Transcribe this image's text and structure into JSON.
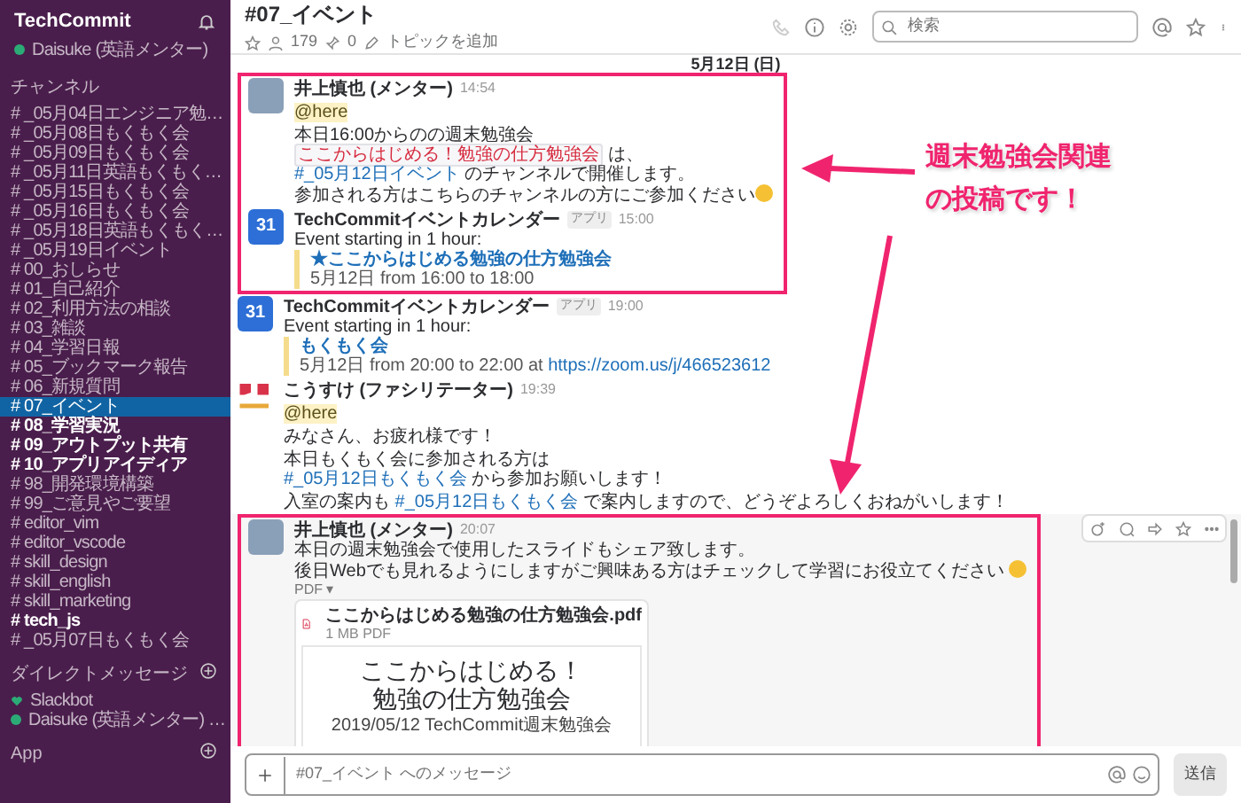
{
  "workspace": {
    "name": "TechCommit",
    "user": "Daisuke (英語メンター)"
  },
  "sidebar": {
    "channels_heading": "チャンネル",
    "channels": [
      {
        "name": "# _05月04日エンジニア勉…",
        "selected": false,
        "unread": false
      },
      {
        "name": "# _05月08日もくもく会",
        "selected": false,
        "unread": false
      },
      {
        "name": "# _05月09日もくもく会",
        "selected": false,
        "unread": false
      },
      {
        "name": "# _05月11日英語もくもく…",
        "selected": false,
        "unread": false
      },
      {
        "name": "# _05月15日もくもく会",
        "selected": false,
        "unread": false
      },
      {
        "name": "# _05月16日もくもく会",
        "selected": false,
        "unread": false
      },
      {
        "name": "# _05月18日英語もくもく…",
        "selected": false,
        "unread": false
      },
      {
        "name": "# _05月19日イベント",
        "selected": false,
        "unread": false
      },
      {
        "name": "# 00_おしらせ",
        "selected": false,
        "unread": false
      },
      {
        "name": "# 01_自己紹介",
        "selected": false,
        "unread": false
      },
      {
        "name": "# 02_利用方法の相談",
        "selected": false,
        "unread": false
      },
      {
        "name": "# 03_雑談",
        "selected": false,
        "unread": false
      },
      {
        "name": "# 04_学習日報",
        "selected": false,
        "unread": false
      },
      {
        "name": "# 05_ブックマーク報告",
        "selected": false,
        "unread": false
      },
      {
        "name": "# 06_新規質問",
        "selected": false,
        "unread": false
      },
      {
        "name": "# 07_イベント",
        "selected": true,
        "unread": false
      },
      {
        "name": "# 08_学習実況",
        "selected": false,
        "unread": true
      },
      {
        "name": "# 09_アウトプット共有",
        "selected": false,
        "unread": true
      },
      {
        "name": "# 10_アプリアイディア",
        "selected": false,
        "unread": true
      },
      {
        "name": "# 98_開発環境構築",
        "selected": false,
        "unread": false
      },
      {
        "name": "# 99_ご意見やご要望",
        "selected": false,
        "unread": false
      },
      {
        "name": "# editor_vim",
        "selected": false,
        "unread": false
      },
      {
        "name": "# editor_vscode",
        "selected": false,
        "unread": false
      },
      {
        "name": "# skill_design",
        "selected": false,
        "unread": false
      },
      {
        "name": "# skill_english",
        "selected": false,
        "unread": false
      },
      {
        "name": "# skill_marketing",
        "selected": false,
        "unread": false
      },
      {
        "name": "# tech_js",
        "selected": false,
        "unread": true
      },
      {
        "name": "# _05月07日もくもく会",
        "selected": false,
        "unread": false
      }
    ],
    "dm_heading": "ダイレクトメッセージ",
    "direct_messages": [
      {
        "kind": "bot",
        "name": "Slackbot"
      },
      {
        "kind": "user",
        "name": "Daisuke (英語メンター) …"
      }
    ],
    "apps_heading": "App"
  },
  "channel_header": {
    "title": "#07_イベント",
    "members": "179",
    "pins": "0",
    "topic": "トピックを追加",
    "search": {
      "placeholder": "検索"
    }
  },
  "date_divider": "5月12日 (日)",
  "groups": [
    {
      "framed": true,
      "hovered": false,
      "messages": [
        {
          "kind": "user",
          "author": "井上慎也 (メンター)",
          "time": "14:54",
          "mention": "@here",
          "paragraphs": [
            [
              [
                {
                  "kind": "text",
                  "text": "本日16:00からのの週末勉強会"
                }
              ],
              [
                {
                  "kind": "code",
                  "text": "ここからはじめる！勉強の仕方勉強会"
                },
                {
                  "kind": "text",
                  "text": " は、"
                }
              ],
              [
                {
                  "kind": "link",
                  "text": "#_05月12日イベント"
                },
                {
                  "kind": "text",
                  "text": " のチャンネルで開催します。"
                }
              ],
              [
                {
                  "kind": "text",
                  "text": "参加される方はこちらのチャンネルの方にご参加ください"
                },
                {
                  "kind": "emoji"
                }
              ]
            ]
          ]
        },
        {
          "kind": "app",
          "avatar_text": "31",
          "author": "TechCommitイベントカレンダー",
          "badge": "アプリ",
          "time": "15:00",
          "paragraphs": [
            [
              [
                {
                  "kind": "text",
                  "text": "Event starting in 1 hour:"
                }
              ]
            ]
          ],
          "attachment": {
            "title": "★ここからはじめる勉強の仕方勉強会",
            "detail": [
              {
                "kind": "text",
                "text": "5月12日 from 16:00 to 18:00"
              }
            ]
          }
        }
      ]
    },
    {
      "framed": false,
      "hovered": false,
      "messages": [
        {
          "kind": "app",
          "avatar_text": "31",
          "author": "TechCommitイベントカレンダー",
          "badge": "アプリ",
          "time": "19:00",
          "paragraphs": [
            [
              [
                {
                  "kind": "text",
                  "text": "Event starting in 1 hour:"
                }
              ]
            ]
          ],
          "attachment": {
            "title": "もくもく会",
            "detail": [
              {
                "kind": "text",
                "text": "5月12日 from 20:00 to 22:00 at "
              },
              {
                "kind": "link",
                "text": "https://zoom.us/j/466523612"
              }
            ]
          }
        },
        {
          "kind": "logo",
          "author": "こうすけ (ファシリテーター)",
          "time": "19:39",
          "mention": "@here",
          "paragraphs": [
            [
              [
                {
                  "kind": "text",
                  "text": "みなさん、お疲れ様です！"
                }
              ]
            ],
            [
              [
                {
                  "kind": "text",
                  "text": "本日もくもく会に参加される方は"
                }
              ],
              [
                {
                  "kind": "link",
                  "text": "#_05月12日もくもく会"
                },
                {
                  "kind": "text",
                  "text": " から参加お願いします！"
                }
              ]
            ],
            [
              [
                {
                  "kind": "text",
                  "text": "入室の案内も "
                },
                {
                  "kind": "link",
                  "text": "#_05月12日もくもく会"
                },
                {
                  "kind": "text",
                  "text": " で案内しますので、どうぞよろしくおねがいします！"
                }
              ]
            ]
          ]
        }
      ]
    },
    {
      "framed": true,
      "hovered": true,
      "messages": [
        {
          "kind": "user",
          "author": "井上慎也 (メンター)",
          "time": "20:07",
          "paragraphs": [
            [
              [
                {
                  "kind": "text",
                  "text": "本日の週末勉強会で使用したスライドもシェア致します。"
                }
              ],
              [
                {
                  "kind": "text",
                  "text": "後日Webでも見れるようにしますがご興味ある方はチェックして学習にお役立てください "
                },
                {
                  "kind": "emoji"
                }
              ]
            ]
          ],
          "file": {
            "type_label": "PDF ▾",
            "name": "ここからはじめる勉強の仕方勉強会.pdf",
            "meta": "1 MB PDF",
            "preview": [
              "ここからはじめる！",
              "勉強の仕方勉強会",
              "2019/05/12 TechCommit週末勉強会"
            ]
          }
        }
      ]
    }
  ],
  "annotation": {
    "lines": [
      "週末勉強会関連",
      "の投稿です！"
    ]
  },
  "composer": {
    "placeholder": "#07_イベント へのメッセージ",
    "send": "送信"
  }
}
